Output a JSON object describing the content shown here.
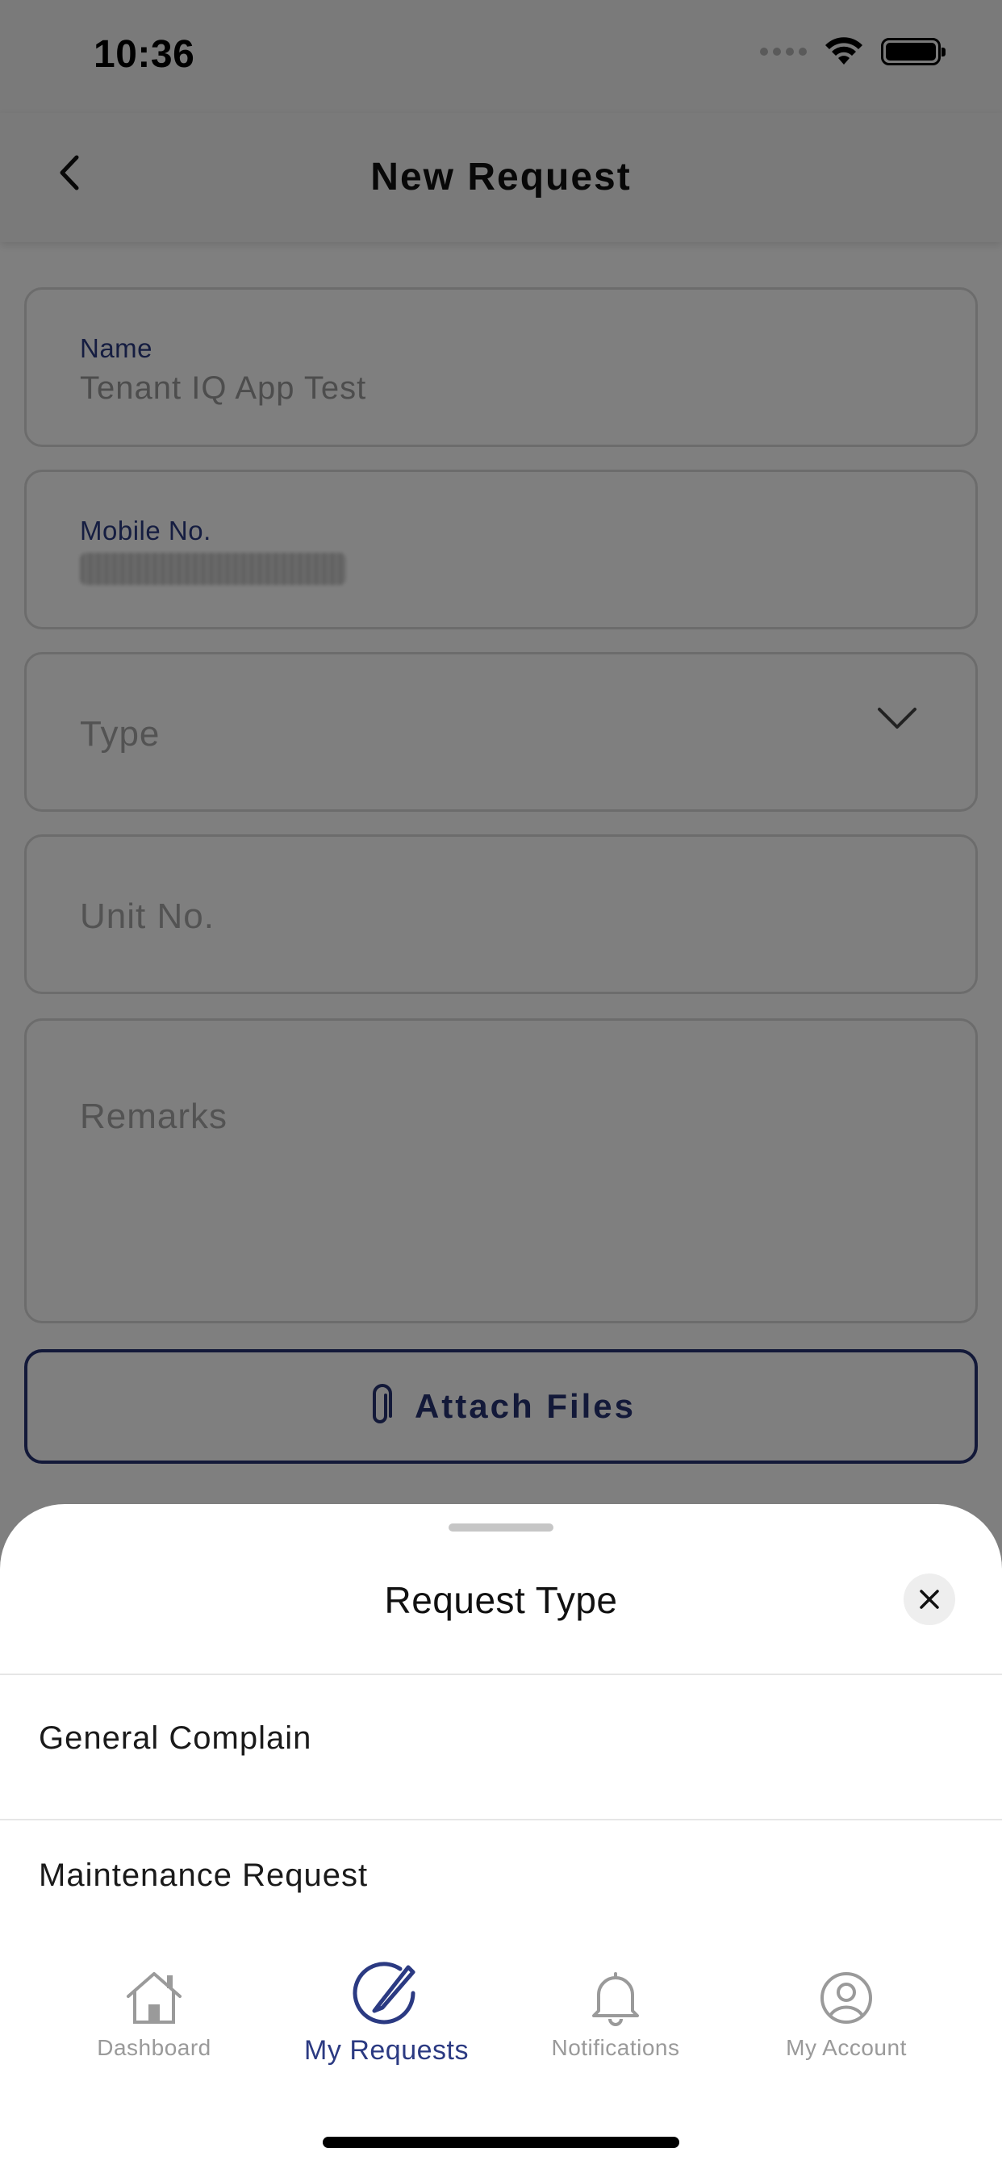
{
  "status_bar": {
    "time": "10:36"
  },
  "nav": {
    "title": "New Request"
  },
  "form": {
    "name": {
      "label": "Name",
      "value": "Tenant IQ App Test"
    },
    "mobile": {
      "label": "Mobile No."
    },
    "type": {
      "placeholder": "Type"
    },
    "unit": {
      "placeholder": "Unit No."
    },
    "remarks": {
      "placeholder": "Remarks"
    },
    "attach_label": "Attach Files"
  },
  "sheet": {
    "title": "Request Type",
    "options": [
      {
        "label": "General Complain"
      },
      {
        "label": "Maintenance Request"
      }
    ]
  },
  "tabs": [
    {
      "label": "Dashboard",
      "icon": "home-icon"
    },
    {
      "label": "My Requests",
      "icon": "edit-circle-icon",
      "active": true
    },
    {
      "label": "Notifications",
      "icon": "bell-icon"
    },
    {
      "label": "My Account",
      "icon": "user-circle-icon"
    }
  ],
  "colors": {
    "accent": "#2b3a82",
    "overlay": "rgba(0,0,0,0.5)"
  }
}
